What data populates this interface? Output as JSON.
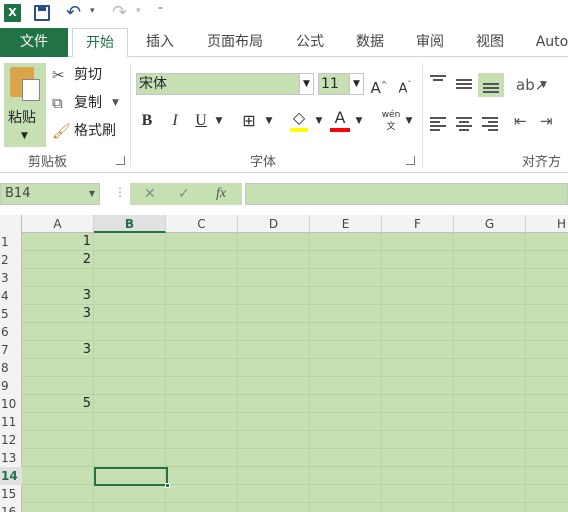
{
  "app": {
    "title": "Excel"
  },
  "quick_access": {
    "undo_dd": "▾",
    "redo_dd": "▾",
    "customize": "⁼"
  },
  "tabs": [
    {
      "label": "文件"
    },
    {
      "label": "开始"
    },
    {
      "label": "插入"
    },
    {
      "label": "页面布局"
    },
    {
      "label": "公式"
    },
    {
      "label": "数据"
    },
    {
      "label": "审阅"
    },
    {
      "label": "视图"
    },
    {
      "label": "Auto"
    }
  ],
  "ribbon": {
    "clipboard": {
      "paste": "粘贴",
      "cut": "剪切",
      "copy": "复制",
      "format_painter": "格式刷",
      "group_label": "剪贴板"
    },
    "font": {
      "font_name": "宋体",
      "font_size": "11",
      "bold": "B",
      "italic": "I",
      "underline": "U",
      "phonetic": "wén",
      "group_label": "字体",
      "fill_color": "#ffff00",
      "font_color": "#ff0000"
    },
    "alignment": {
      "group_label": "对齐方"
    }
  },
  "formula_bar": {
    "name_box": "B14",
    "cancel": "✕",
    "enter": "✓",
    "fx": "fx",
    "value": ""
  },
  "sheet": {
    "columns": [
      "A",
      "B",
      "C",
      "D",
      "E",
      "F",
      "G",
      "H"
    ],
    "active_column": "B",
    "rows": [
      "1",
      "2",
      "3",
      "4",
      "5",
      "6",
      "7",
      "8",
      "9",
      "10",
      "11",
      "12",
      "13",
      "14",
      "15",
      "16"
    ],
    "active_row": "14",
    "cells": [
      {
        "ref": "A1",
        "value": "1"
      },
      {
        "ref": "A2",
        "value": "2"
      },
      {
        "ref": "A4",
        "value": "3"
      },
      {
        "ref": "A5",
        "value": "3"
      },
      {
        "ref": "A7",
        "value": "3"
      },
      {
        "ref": "A10",
        "value": "5"
      }
    ],
    "selected_cell": "B14"
  },
  "colors": {
    "excel_green": "#217346",
    "sheet_bg": "#c6e0b4"
  }
}
